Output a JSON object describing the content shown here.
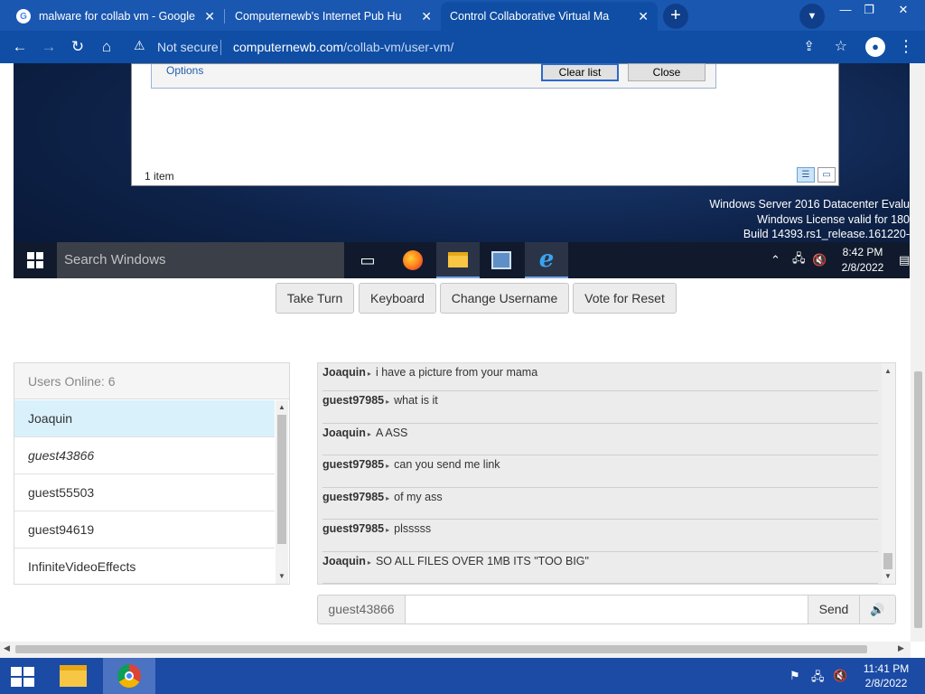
{
  "browser": {
    "tabs": [
      {
        "title": "malware for collab vm - Google S",
        "favicon": "google-icon",
        "active": false
      },
      {
        "title": "Computernewb's Internet Pub Hu",
        "favicon": "computernewb-icon",
        "active": false
      },
      {
        "title": "Control Collaborative Virtual Ma",
        "favicon": "computernewb-icon",
        "active": true
      }
    ],
    "security_label": "Not secure",
    "url_host": "computernewb.com",
    "url_path": "/collab-vm/user-vm/"
  },
  "vm": {
    "dialog": {
      "options_label": "Options",
      "clear_list_label": "Clear list",
      "close_label": "Close"
    },
    "explorer_status": "1 item",
    "watermark": [
      "Windows Server 2016 Datacenter Evalu",
      "Windows License valid for 180",
      "Build 14393.rs1_release.161220-"
    ],
    "taskbar": {
      "search_placeholder": "Search Windows",
      "time": "8:42 PM",
      "date": "2/8/2022"
    }
  },
  "controls": {
    "take_turn": "Take Turn",
    "keyboard": "Keyboard",
    "change_username": "Change Username",
    "vote_reset": "Vote for Reset"
  },
  "users": {
    "header": "Users Online: 6",
    "list": [
      {
        "name": "Joaquin",
        "selected": true,
        "italic": false
      },
      {
        "name": "guest43866",
        "selected": false,
        "italic": true
      },
      {
        "name": "guest55503",
        "selected": false,
        "italic": false
      },
      {
        "name": "guest94619",
        "selected": false,
        "italic": false
      },
      {
        "name": "InfiniteVideoEffects",
        "selected": false,
        "italic": false
      }
    ]
  },
  "chat": {
    "messages": [
      {
        "user": "Joaquin",
        "text": "i have a picture from your mama"
      },
      {
        "user": "guest97985",
        "text": "what is it"
      },
      {
        "user": "Joaquin",
        "text": "A ASS"
      },
      {
        "user": "guest97985",
        "text": "can you send me link"
      },
      {
        "user": "guest97985",
        "text": "of my ass"
      },
      {
        "user": "guest97985",
        "text": "plsssss"
      },
      {
        "user": "Joaquin",
        "text": "SO ALL FILES OVER 1MB ITS \"TOO BIG\""
      }
    ],
    "username": "guest43866",
    "input_value": "",
    "send_label": "Send"
  },
  "host_taskbar": {
    "time": "11:41 PM",
    "date": "2/8/2022"
  }
}
